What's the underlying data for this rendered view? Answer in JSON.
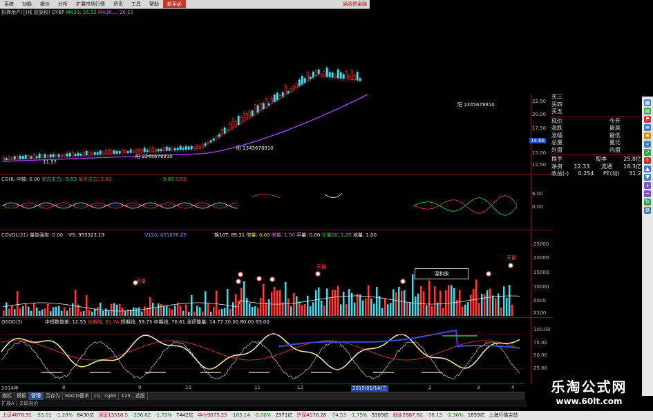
{
  "menubar": {
    "items": [
      "系统",
      "功能",
      "报价",
      "分析",
      "扩展市场行情",
      "资讯",
      "工具",
      "帮助"
    ],
    "active_item": "新手必",
    "right_text": "通达信金融"
  },
  "main_panel": {
    "title": "招商地产(日线 前复权) DYBP",
    "ma30_label": "MA30: 26.52",
    "ma30x_label": "MA30...: 26.52",
    "annotation_low": "11.57",
    "annotation_code1": "阳 2345678910",
    "annotation_code2": "阳 2345678910",
    "annotation_code3": "阳 2345678910",
    "price_ticks": [
      "22.50",
      "20.00",
      "17.50",
      "15.00",
      "12.50"
    ],
    "current_price": "14.66"
  },
  "cohl_panel": {
    "title": "COHL 中轴: 0.00",
    "kong": "空方主力: -5.83",
    "duo": "多方主力: 5.83",
    "extra1": "-5.83",
    "extra2": "5.83",
    "ticks": [
      "6.00",
      "0.00"
    ]
  },
  "covol_panel": {
    "title": "COVOL(21) 量能强度: 0.00",
    "v5": "V5: 955323.19",
    "v120": "V120: 651678.25",
    "labels": [
      "换10T: 89.31",
      "倍量: 0.00",
      "缩量: 1.00",
      "平量: 0.00",
      "长量10: 1.00",
      "地量: 1.00"
    ],
    "box_label": "温和放",
    "ticks": [
      "25000",
      "20000",
      "15000",
      "10000",
      "5000",
      "X100"
    ],
    "peak_labels": [
      "天量",
      "天量",
      "天量"
    ]
  },
  "qsdd_panel": {
    "title": "QSDD(5)",
    "params": [
      "中短数值差: 12.55",
      "长期线: 61.74",
      "短期线: 59.73",
      "中期线: 76.81",
      "涨停能量: 14.77",
      "20.00",
      "80.00",
      "93.00"
    ],
    "ticks": [
      "100.00",
      "75.00",
      "50.00",
      "25.00"
    ]
  },
  "time_axis": {
    "labels": [
      "2014年",
      "8",
      "9",
      "10",
      "11",
      "12",
      "2015/01/14/三",
      "2",
      "3",
      "4"
    ]
  },
  "tabs": [
    "指标",
    "模板",
    "管理",
    "另存为",
    "MACD基本",
    "cq",
    "cg60",
    "123",
    "选股"
  ],
  "subbar_text": "扩展A | 关联报价",
  "quote_panel": {
    "buy_levels": [
      "买三",
      "买四",
      "买五"
    ],
    "rows": [
      {
        "l": "现价",
        "r": "今开"
      },
      {
        "l": "涨跌",
        "r": "最高"
      },
      {
        "l": "涨幅",
        "r": "最低"
      },
      {
        "l": "总量",
        "r": "量比"
      },
      {
        "l": "外盘",
        "r": "内盘"
      }
    ],
    "rows2": [
      {
        "l": "换手",
        "m": "",
        "r": "股本",
        "v": "25.8亿"
      },
      {
        "l": "净资",
        "m": "12.33",
        "r": "流通",
        "v": "18.3亿"
      },
      {
        "l": "收益(-)",
        "m": "0.254",
        "r": "PE(动)",
        "v": "31.2"
      }
    ]
  },
  "status_bar": [
    {
      "t": "上证4078.91",
      "c": "up"
    },
    {
      "t": "-53.01",
      "c": "dn"
    },
    {
      "t": "-1.29%",
      "c": "dn"
    },
    {
      "t": "8430亿",
      "c": ""
    },
    {
      "t": "深证13518.5",
      "c": "up"
    },
    {
      "t": "-236.62",
      "c": "dn"
    },
    {
      "t": "-1.72%",
      "c": "dn"
    },
    {
      "t": "7442亿",
      "c": ""
    },
    {
      "t": "中小9075.25",
      "c": "up"
    },
    {
      "t": "-185.14",
      "c": "dn"
    },
    {
      "t": "-2.00%",
      "c": "dn"
    },
    {
      "t": "2971亿",
      "c": ""
    },
    {
      "t": "沪深4176.28",
      "c": "up"
    },
    {
      "t": "-74.53",
      "c": "dn"
    },
    {
      "t": "-1.75%",
      "c": "dn"
    },
    {
      "t": "5309亿",
      "c": ""
    },
    {
      "t": "创业2887.82",
      "c": "up"
    },
    {
      "t": "-78.13",
      "c": "dn"
    },
    {
      "t": "-2.36%",
      "c": "dn"
    },
    {
      "t": "1859亿",
      "c": ""
    },
    {
      "t": "上海行情主站",
      "c": ""
    }
  ],
  "watermark": {
    "line1": "乐淘公式网",
    "line2": "www.60lt.com"
  },
  "colors": {
    "up": "#ff3b3b",
    "down": "#4fd7e6",
    "ma": "#b040ff",
    "grid": "#7a1515"
  }
}
